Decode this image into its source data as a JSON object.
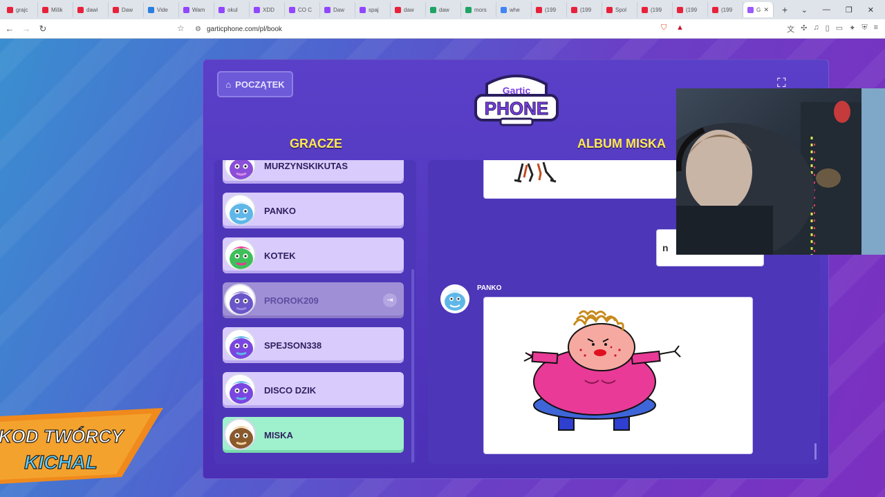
{
  "browser": {
    "tabs": [
      {
        "label": "grajc",
        "color": "#e8213a"
      },
      {
        "label": "Mišk",
        "color": "#e8213a"
      },
      {
        "label": "dawi",
        "color": "#e8213a"
      },
      {
        "label": "Daw",
        "color": "#e8213a"
      },
      {
        "label": "Vide",
        "color": "#2a7de1"
      },
      {
        "label": "Wam",
        "color": "#9146ff"
      },
      {
        "label": "okul",
        "color": "#9146ff"
      },
      {
        "label": "XDD",
        "color": "#9146ff"
      },
      {
        "label": "CO C",
        "color": "#9146ff"
      },
      {
        "label": "Daw",
        "color": "#9146ff"
      },
      {
        "label": "spaj",
        "color": "#9146ff"
      },
      {
        "label": "daw",
        "color": "#e8213a"
      },
      {
        "label": "daw",
        "color": "#1fa463"
      },
      {
        "label": "mors",
        "color": "#1fa463"
      },
      {
        "label": "whe",
        "color": "#4285f4"
      },
      {
        "label": "(199",
        "color": "#e8213a"
      },
      {
        "label": "(199",
        "color": "#e8213a"
      },
      {
        "label": "Spol",
        "color": "#e8213a"
      },
      {
        "label": "(199",
        "color": "#e8213a"
      },
      {
        "label": "(199",
        "color": "#e8213a"
      },
      {
        "label": "(199",
        "color": "#e8213a"
      }
    ],
    "active_tab_label": "G",
    "url": "garticphone.com/pl/book"
  },
  "game": {
    "home_label": "POCZĄTEK",
    "logo_top": "Gartic",
    "logo_bottom": "PHONE",
    "players_title": "GRACZE",
    "album_title": "ALBUM MISKA",
    "players": [
      {
        "name": "MURZYNSKIKUTAS",
        "state": "normal"
      },
      {
        "name": "PANKO",
        "state": "normal"
      },
      {
        "name": "KOTEK",
        "state": "normal"
      },
      {
        "name": "PROROK209",
        "state": "left"
      },
      {
        "name": "SPEJSON338",
        "state": "normal"
      },
      {
        "name": "DISCO DZIK",
        "state": "normal"
      },
      {
        "name": "MISKA",
        "state": "current"
      }
    ],
    "album": {
      "guess_text": "n",
      "author": "PANKO"
    }
  },
  "promo": {
    "line1": "KOD TWÓRCY",
    "line2": "KICHAL"
  },
  "colors": {
    "title_yellow": "#ffe94d",
    "current_player": "#9ff0cc",
    "player_card": "#d9cbfb"
  }
}
